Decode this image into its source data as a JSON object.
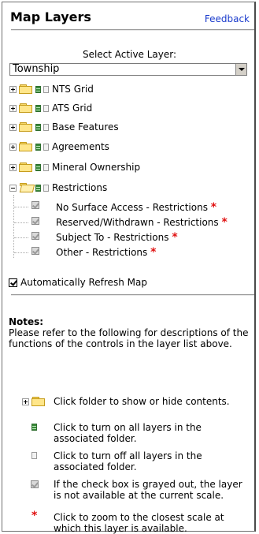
{
  "header": {
    "title": "Map Layers",
    "feedback": "Feedback"
  },
  "select": {
    "label": "Select Active Layer:",
    "value": "Township"
  },
  "tree": {
    "folders": [
      {
        "label": "NTS Grid"
      },
      {
        "label": "ATS Grid"
      },
      {
        "label": "Base Features"
      },
      {
        "label": "Agreements"
      },
      {
        "label": "Mineral Ownership"
      },
      {
        "label": "Restrictions"
      }
    ],
    "restriction_layers": [
      {
        "label": "No Surface Access - Restrictions",
        "star": "*"
      },
      {
        "label": "Reserved/Withdrawn - Restrictions",
        "star": "*"
      },
      {
        "label": "Subject To - Restrictions",
        "star": "*"
      },
      {
        "label": "Other - Restrictions",
        "star": "*"
      }
    ]
  },
  "auto_refresh": {
    "label": "Automatically Refresh Map",
    "checked": true
  },
  "notes": {
    "heading": "Notes:",
    "intro": "Please refer to the following for descriptions of the functions of the controls in the layer list above.",
    "items": [
      {
        "icon": "folder-toggle-icon",
        "text": "Click folder to show or hide contents."
      },
      {
        "icon": "layers-on-icon",
        "text": "Click to turn on all layers in the associated folder."
      },
      {
        "icon": "layers-off-icon",
        "text": "Click to turn off all layers in the associated folder."
      },
      {
        "icon": "grayed-checkbox-icon",
        "text": "If the check box is grayed out, the layer is not available at the current scale."
      },
      {
        "icon": "red-star-icon",
        "text": "Click to zoom to the closest scale at which this layer is available."
      }
    ]
  },
  "colors": {
    "link": "#1a3bcc",
    "star": "#e01010",
    "folder": "#ffe68a"
  }
}
